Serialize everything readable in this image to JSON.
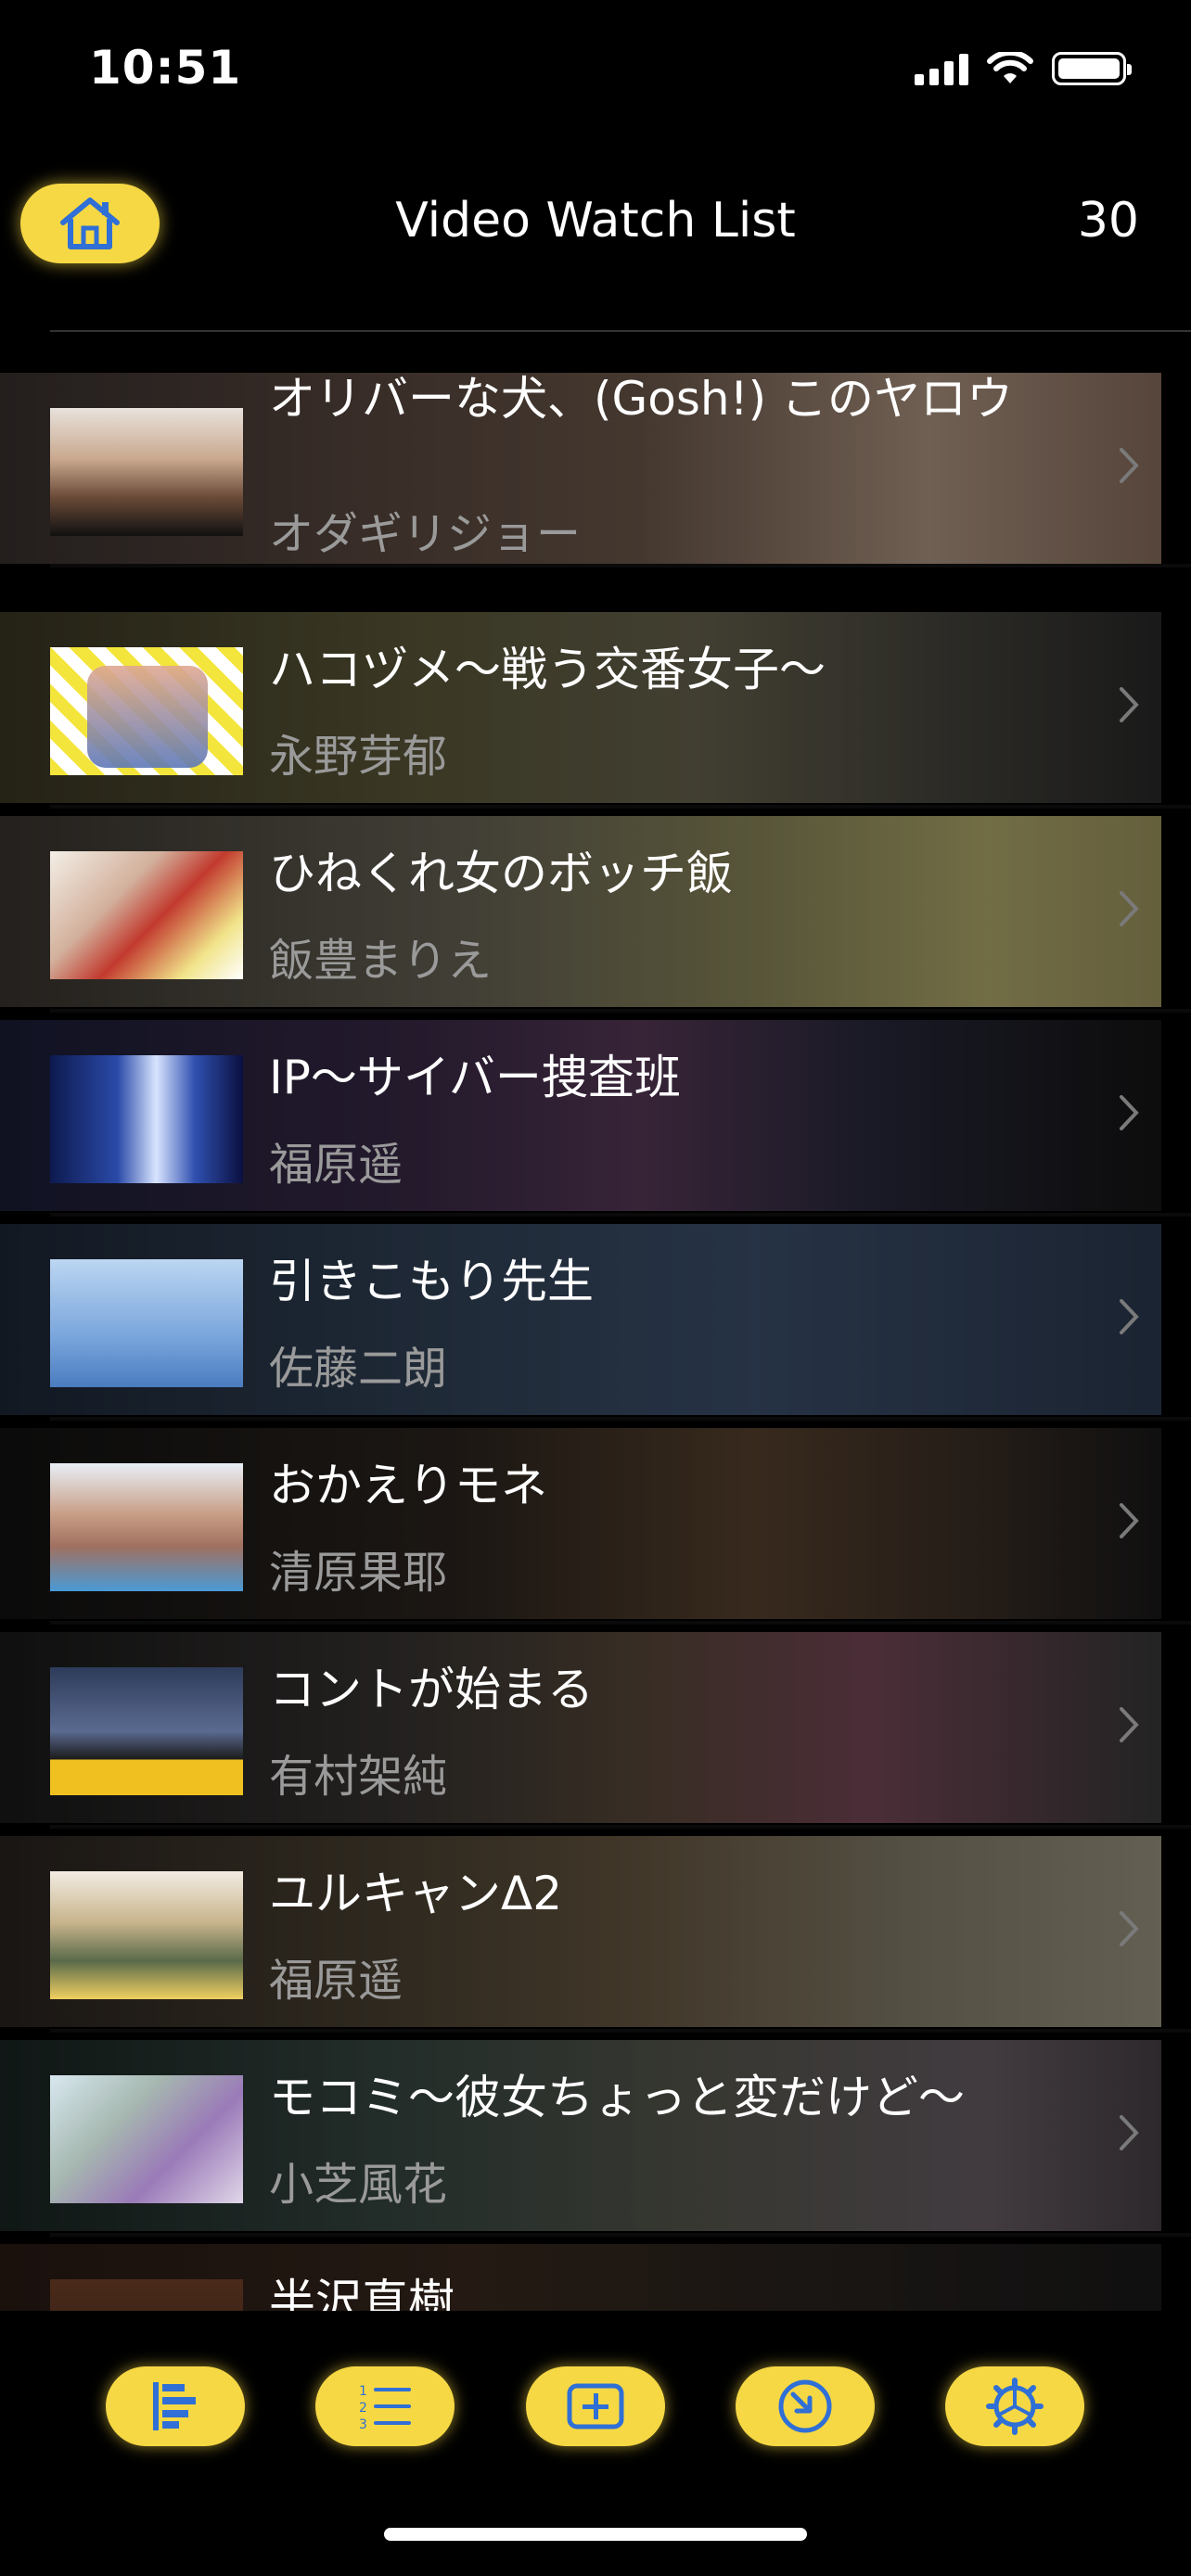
{
  "status_bar": {
    "time": "10:51"
  },
  "nav": {
    "title": "Video Watch List",
    "count": "30"
  },
  "rows": [
    {
      "title": "オリバーな犬、(Gosh!) このヤロウ",
      "subtitle": "オダギリジョー"
    },
    {
      "title": "ハコヅメ〜戦う交番女子〜",
      "subtitle": "永野芽郁"
    },
    {
      "title": "ひねくれ女のボッチ飯",
      "subtitle": "飯豊まりえ"
    },
    {
      "title": "IP〜サイバー捜査班",
      "subtitle": "福原遥"
    },
    {
      "title": "引きこもり先生",
      "subtitle": "佐藤二朗"
    },
    {
      "title": "おかえりモネ",
      "subtitle": "清原果耶"
    },
    {
      "title": "コントが始まる",
      "subtitle": "有村架純"
    },
    {
      "title": "ユルキャンΔ2",
      "subtitle": "福原遥"
    },
    {
      "title": "モコミ〜彼女ちょっと変だけど〜",
      "subtitle": "小芝風花"
    },
    {
      "title": "半沢直樹",
      "subtitle": ""
    }
  ],
  "tabbar": {
    "icons": [
      "bar-chart-icon",
      "numbered-list-icon",
      "add-box-icon",
      "shrink-icon",
      "settings-gear-icon"
    ]
  },
  "colors": {
    "accent": "#f6d844",
    "icon_blue": "#2f6fd6",
    "background": "#000000",
    "subtitle": "#9a9a9a"
  }
}
